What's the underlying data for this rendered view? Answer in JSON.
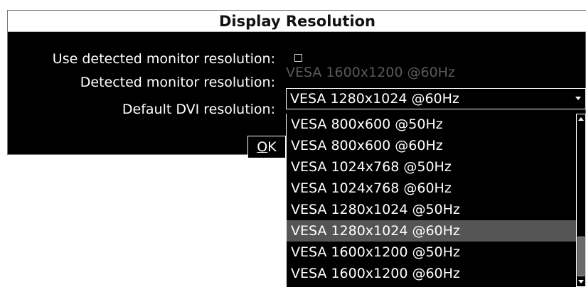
{
  "dialog": {
    "title": "Display Resolution",
    "use_detected_label": "Use detected monitor resolution:",
    "use_detected_checked": false,
    "detected_label": "Detected monitor resolution:",
    "detected_value": "VESA 1600x1200 @60Hz",
    "default_dvi_label": "Default DVI resolution:",
    "default_dvi_value": "VESA 1280x1024 @60Hz",
    "ok_mnemonic": "O",
    "ok_rest": "K"
  },
  "dropdown": {
    "options": [
      "VESA 800x600 @50Hz",
      "VESA 800x600 @60Hz",
      "VESA 1024x768 @50Hz",
      "VESA 1024x768 @60Hz",
      "VESA 1280x1024 @50Hz",
      "VESA 1280x1024 @60Hz",
      "VESA 1600x1200 @50Hz",
      "VESA 1600x1200 @60Hz"
    ],
    "selected": "VESA 1280x1024 @60Hz"
  },
  "colors": {
    "background": "#000000",
    "foreground": "#ffffff",
    "disabled_text": "#5a5a5a",
    "selection": "#555555",
    "title_background": "#ffffff"
  }
}
